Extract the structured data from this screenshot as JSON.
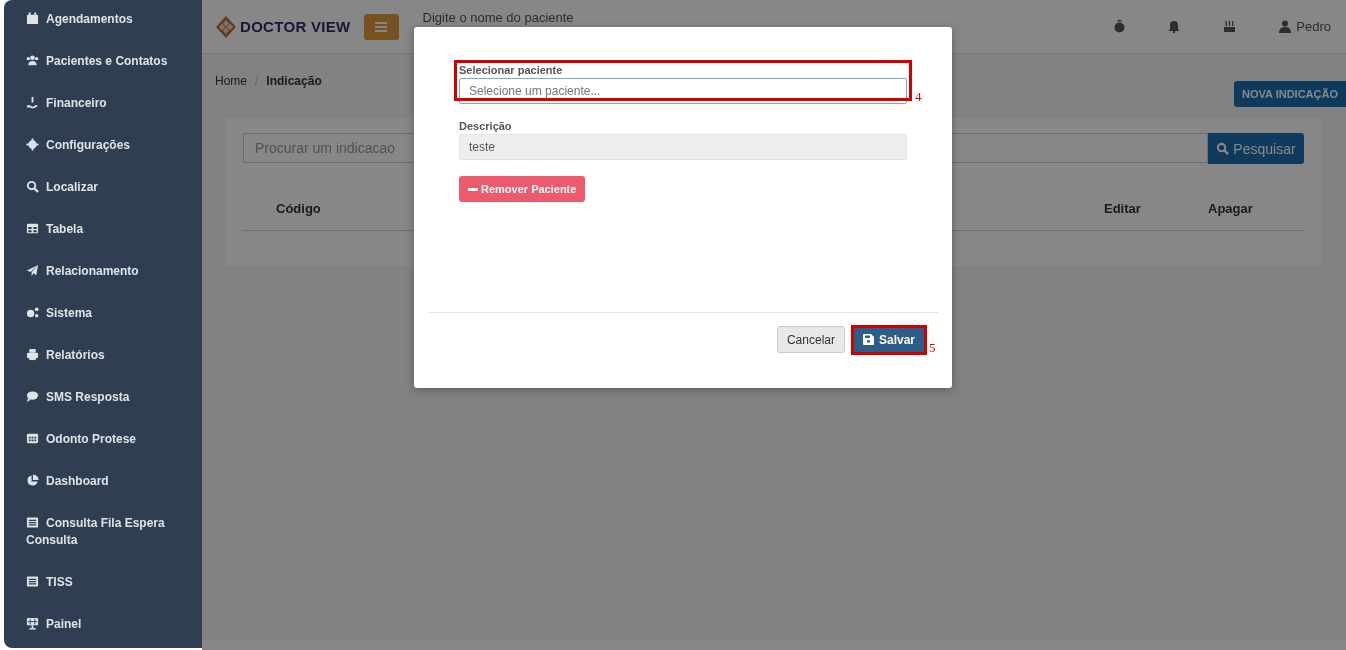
{
  "sidebar": {
    "items": [
      {
        "label": "Agendamentos"
      },
      {
        "label": "Pacientes e Contatos"
      },
      {
        "label": "Financeiro"
      },
      {
        "label": "Configurações"
      },
      {
        "label": "Localizar"
      },
      {
        "label": "Tabela"
      },
      {
        "label": "Relacionamento"
      },
      {
        "label": "Sistema"
      },
      {
        "label": "Relatórios"
      },
      {
        "label": "SMS Resposta"
      },
      {
        "label": "Odonto Protese"
      },
      {
        "label": "Dashboard"
      },
      {
        "label": "Consulta Fila Espera Consulta"
      },
      {
        "label": "TISS"
      },
      {
        "label": "Painel"
      }
    ]
  },
  "header": {
    "logo": "DOCTOR VIEW",
    "search": {
      "placeholder": "Digite o nome do paciente"
    },
    "user": "Pedro"
  },
  "breadcrumb": {
    "items": [
      "Home",
      "Indicação"
    ],
    "separator": "/"
  },
  "new_button": "NOVA INDICAÇÃO",
  "search": {
    "placeholder": "Procurar um indicacao",
    "button": "Pesquisar"
  },
  "table": {
    "columns": [
      "Código",
      "Editar",
      "Apagar"
    ]
  },
  "modal": {
    "fields": [
      {
        "label": "Selecionar paciente",
        "placeholder": "Selecione um paciente...",
        "disabled": false,
        "annotation": "4"
      },
      {
        "label": "Descrição",
        "value": "teste",
        "disabled": true
      }
    ],
    "remove_button": "Remover Paciente",
    "buttons": [
      {
        "label": "Cancelar",
        "kind": "default"
      },
      {
        "label": "Salvar",
        "kind": "primary",
        "annotation": "5"
      }
    ]
  }
}
